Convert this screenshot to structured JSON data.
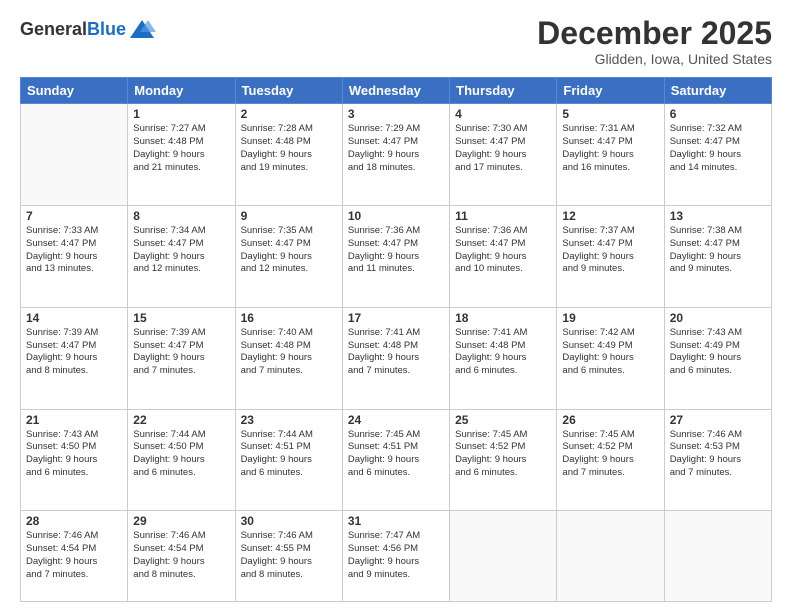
{
  "logo": {
    "general": "General",
    "blue": "Blue"
  },
  "header": {
    "month": "December 2025",
    "location": "Glidden, Iowa, United States"
  },
  "weekdays": [
    "Sunday",
    "Monday",
    "Tuesday",
    "Wednesday",
    "Thursday",
    "Friday",
    "Saturday"
  ],
  "weeks": [
    [
      {
        "day": "",
        "info": ""
      },
      {
        "day": "1",
        "info": "Sunrise: 7:27 AM\nSunset: 4:48 PM\nDaylight: 9 hours\nand 21 minutes."
      },
      {
        "day": "2",
        "info": "Sunrise: 7:28 AM\nSunset: 4:48 PM\nDaylight: 9 hours\nand 19 minutes."
      },
      {
        "day": "3",
        "info": "Sunrise: 7:29 AM\nSunset: 4:47 PM\nDaylight: 9 hours\nand 18 minutes."
      },
      {
        "day": "4",
        "info": "Sunrise: 7:30 AM\nSunset: 4:47 PM\nDaylight: 9 hours\nand 17 minutes."
      },
      {
        "day": "5",
        "info": "Sunrise: 7:31 AM\nSunset: 4:47 PM\nDaylight: 9 hours\nand 16 minutes."
      },
      {
        "day": "6",
        "info": "Sunrise: 7:32 AM\nSunset: 4:47 PM\nDaylight: 9 hours\nand 14 minutes."
      }
    ],
    [
      {
        "day": "7",
        "info": "Sunrise: 7:33 AM\nSunset: 4:47 PM\nDaylight: 9 hours\nand 13 minutes."
      },
      {
        "day": "8",
        "info": "Sunrise: 7:34 AM\nSunset: 4:47 PM\nDaylight: 9 hours\nand 12 minutes."
      },
      {
        "day": "9",
        "info": "Sunrise: 7:35 AM\nSunset: 4:47 PM\nDaylight: 9 hours\nand 12 minutes."
      },
      {
        "day": "10",
        "info": "Sunrise: 7:36 AM\nSunset: 4:47 PM\nDaylight: 9 hours\nand 11 minutes."
      },
      {
        "day": "11",
        "info": "Sunrise: 7:36 AM\nSunset: 4:47 PM\nDaylight: 9 hours\nand 10 minutes."
      },
      {
        "day": "12",
        "info": "Sunrise: 7:37 AM\nSunset: 4:47 PM\nDaylight: 9 hours\nand 9 minutes."
      },
      {
        "day": "13",
        "info": "Sunrise: 7:38 AM\nSunset: 4:47 PM\nDaylight: 9 hours\nand 9 minutes."
      }
    ],
    [
      {
        "day": "14",
        "info": "Sunrise: 7:39 AM\nSunset: 4:47 PM\nDaylight: 9 hours\nand 8 minutes."
      },
      {
        "day": "15",
        "info": "Sunrise: 7:39 AM\nSunset: 4:47 PM\nDaylight: 9 hours\nand 7 minutes."
      },
      {
        "day": "16",
        "info": "Sunrise: 7:40 AM\nSunset: 4:48 PM\nDaylight: 9 hours\nand 7 minutes."
      },
      {
        "day": "17",
        "info": "Sunrise: 7:41 AM\nSunset: 4:48 PM\nDaylight: 9 hours\nand 7 minutes."
      },
      {
        "day": "18",
        "info": "Sunrise: 7:41 AM\nSunset: 4:48 PM\nDaylight: 9 hours\nand 6 minutes."
      },
      {
        "day": "19",
        "info": "Sunrise: 7:42 AM\nSunset: 4:49 PM\nDaylight: 9 hours\nand 6 minutes."
      },
      {
        "day": "20",
        "info": "Sunrise: 7:43 AM\nSunset: 4:49 PM\nDaylight: 9 hours\nand 6 minutes."
      }
    ],
    [
      {
        "day": "21",
        "info": "Sunrise: 7:43 AM\nSunset: 4:50 PM\nDaylight: 9 hours\nand 6 minutes."
      },
      {
        "day": "22",
        "info": "Sunrise: 7:44 AM\nSunset: 4:50 PM\nDaylight: 9 hours\nand 6 minutes."
      },
      {
        "day": "23",
        "info": "Sunrise: 7:44 AM\nSunset: 4:51 PM\nDaylight: 9 hours\nand 6 minutes."
      },
      {
        "day": "24",
        "info": "Sunrise: 7:45 AM\nSunset: 4:51 PM\nDaylight: 9 hours\nand 6 minutes."
      },
      {
        "day": "25",
        "info": "Sunrise: 7:45 AM\nSunset: 4:52 PM\nDaylight: 9 hours\nand 6 minutes."
      },
      {
        "day": "26",
        "info": "Sunrise: 7:45 AM\nSunset: 4:52 PM\nDaylight: 9 hours\nand 7 minutes."
      },
      {
        "day": "27",
        "info": "Sunrise: 7:46 AM\nSunset: 4:53 PM\nDaylight: 9 hours\nand 7 minutes."
      }
    ],
    [
      {
        "day": "28",
        "info": "Sunrise: 7:46 AM\nSunset: 4:54 PM\nDaylight: 9 hours\nand 7 minutes."
      },
      {
        "day": "29",
        "info": "Sunrise: 7:46 AM\nSunset: 4:54 PM\nDaylight: 9 hours\nand 8 minutes."
      },
      {
        "day": "30",
        "info": "Sunrise: 7:46 AM\nSunset: 4:55 PM\nDaylight: 9 hours\nand 8 minutes."
      },
      {
        "day": "31",
        "info": "Sunrise: 7:47 AM\nSunset: 4:56 PM\nDaylight: 9 hours\nand 9 minutes."
      },
      {
        "day": "",
        "info": ""
      },
      {
        "day": "",
        "info": ""
      },
      {
        "day": "",
        "info": ""
      }
    ]
  ]
}
